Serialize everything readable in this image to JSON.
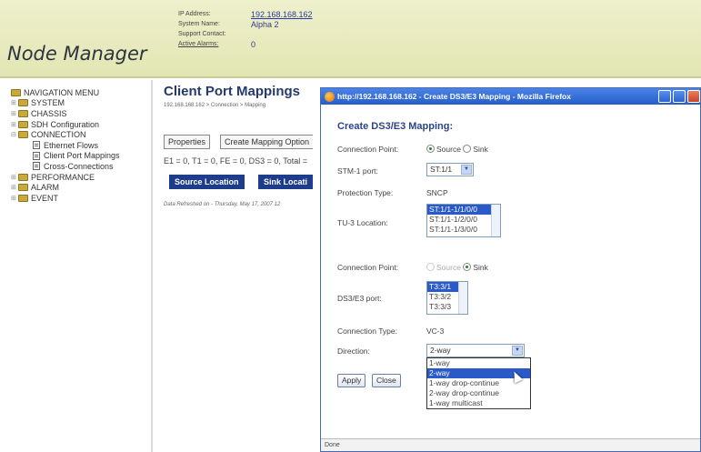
{
  "header": {
    "logo": "Node Manager",
    "ip_label": "IP Address:",
    "ip_value": "192.168.168.162",
    "sysname_label": "System Name:",
    "sysname_value": "Alpha 2",
    "contact_label": "Support Contact:",
    "contact_value": "",
    "alarms_label": "Active Alarms:",
    "alarms_value": "0"
  },
  "nav": {
    "items": [
      {
        "label": "NAVIGATION MENU"
      },
      {
        "label": "SYSTEM"
      },
      {
        "label": "CHASSIS"
      },
      {
        "label": "SDH Configuration"
      },
      {
        "label": "CONNECTION"
      },
      {
        "label": "Ethernet Flows"
      },
      {
        "label": "Client Port Mappings"
      },
      {
        "label": "Cross-Connections"
      },
      {
        "label": "PERFORMANCE"
      },
      {
        "label": "ALARM"
      },
      {
        "label": "EVENT"
      }
    ]
  },
  "main": {
    "title": "Client Port Mappings",
    "breadcrumb": "192.168.168.162 > Connection > Mapping",
    "properties_btn": "Properties",
    "create_btn": "Create Mapping Option",
    "counts": "E1 = 0, T1 = 0, FE = 0, DS3 = 0, Total =",
    "col_source": "Source Location",
    "col_sink": "Sink Locati",
    "refreshed": "Data Refreshed on - Thursday, May 17, 2007 12"
  },
  "popup": {
    "title": "http://192.168.168.162 - Create DS3/E3 Mapping - Mozilla Firefox",
    "heading": "Create DS3/E3 Mapping:",
    "cp1_label": "Connection Point:",
    "cp1_source": "Source",
    "cp1_sink": "Sink",
    "stm_label": "STM-1 port:",
    "stm_value": "ST:1/1",
    "prot_label": "Protection Type:",
    "prot_value": "SNCP",
    "tu3_label": "TU-3 Location:",
    "tu3_options": [
      "ST:1/1-1/1/0/0",
      "ST:1/1-1/2/0/0",
      "ST:1/1-1/3/0/0"
    ],
    "cp2_label": "Connection Point:",
    "cp2_source": "Source",
    "cp2_sink": "Sink",
    "ds3_label": "DS3/E3 port:",
    "ds3_options": [
      "T3:3/1",
      "T3:3/2",
      "T3:3/3"
    ],
    "conn_type_label": "Connection Type:",
    "conn_type_value": "VC-3",
    "direction_label": "Direction:",
    "direction_value": "2-way",
    "direction_options": [
      "1-way",
      "2-way",
      "1-way drop-continue",
      "2-way drop-continue",
      "1-way multicast"
    ],
    "apply_btn": "Apply",
    "close_btn": "Close",
    "status": "Done"
  }
}
